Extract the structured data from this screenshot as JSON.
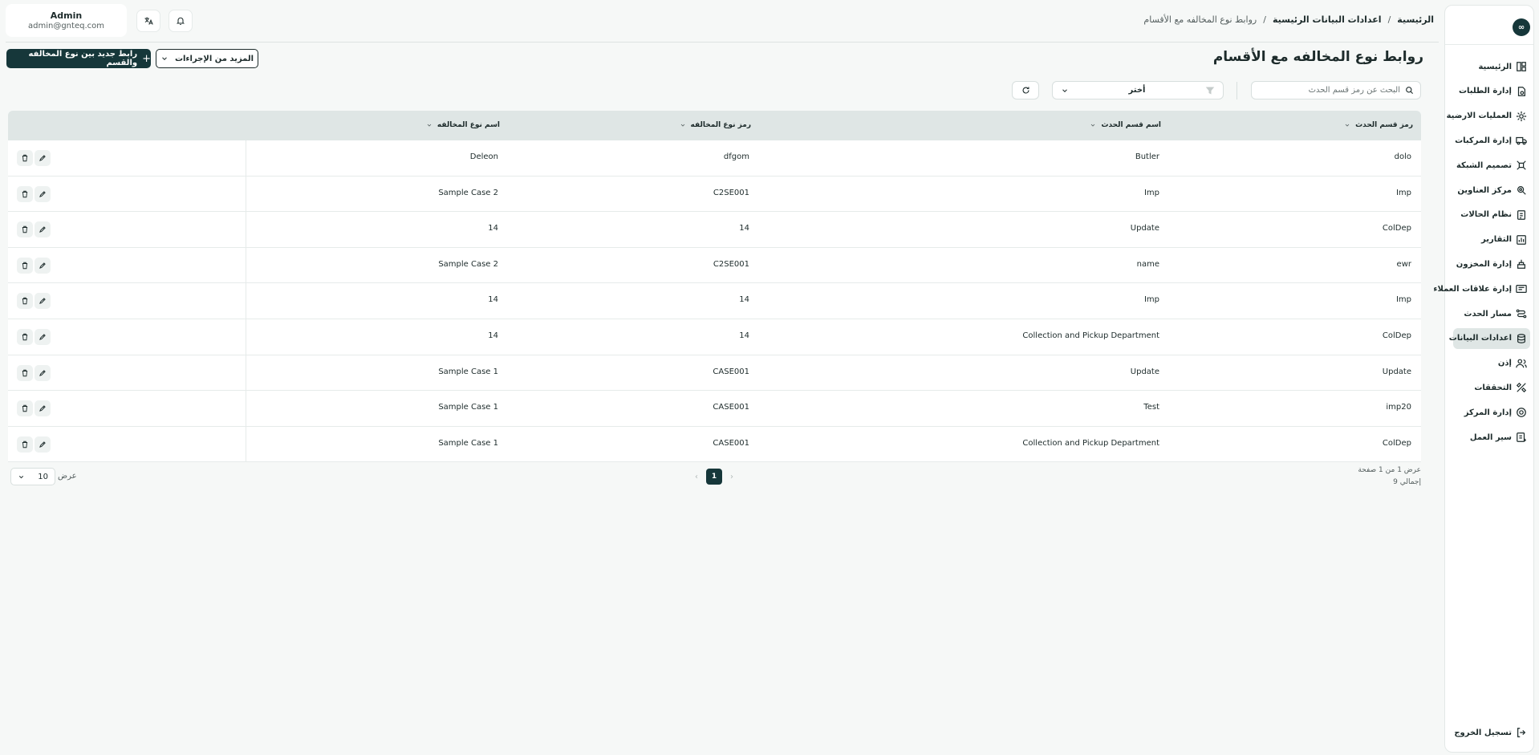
{
  "header": {
    "user": {
      "name": "Admin",
      "email": "admin@gnteq.com"
    },
    "breadcrumb": [
      "الرئيسية",
      "اعدادات البيانات الرئيسية",
      "روابط نوع المخالفه مع الأقسام"
    ],
    "breadcrumb_sep": "/"
  },
  "sidebar": {
    "logo": "∞",
    "items": [
      {
        "label": "الرئيسية",
        "icon": "dashboard-icon"
      },
      {
        "label": "إدارة الطلبات",
        "icon": "orders-icon"
      },
      {
        "label": "العمليات الارضية",
        "icon": "ground-ops-icon"
      },
      {
        "label": "إدارة المركبات",
        "icon": "truck-icon"
      },
      {
        "label": "تصميم الشبكة",
        "icon": "network-icon"
      },
      {
        "label": "مركز العناوين",
        "icon": "address-icon"
      },
      {
        "label": "نظام الحالات",
        "icon": "status-icon"
      },
      {
        "label": "التقارير",
        "icon": "reports-icon"
      },
      {
        "label": "إدارة المخزون",
        "icon": "inventory-icon"
      },
      {
        "label": "إدارة علاقات العملاء",
        "icon": "crm-icon"
      },
      {
        "label": "مسار الحدث",
        "icon": "route-icon"
      },
      {
        "label": "اعدادات البيانات",
        "icon": "database-icon",
        "active": true
      },
      {
        "label": "إذن",
        "icon": "users-icon"
      },
      {
        "label": "التحققات",
        "icon": "verification-icon"
      },
      {
        "label": "إدارة المركز",
        "icon": "center-icon"
      },
      {
        "label": "سير العمل",
        "icon": "workflow-icon"
      }
    ],
    "logout": "تسجيل الخروج"
  },
  "page": {
    "title": "روابط نوع المخالفه مع الأقسام",
    "new_button": "رابط جديد بين نوع المخالفه والقسم",
    "more_actions": "المزيد من الإجراءات"
  },
  "filters": {
    "search_placeholder": "البحث عن رمز قسم الحدث",
    "select_value": "أختر"
  },
  "table": {
    "columns": [
      "رمز قسم الحدث",
      "اسم قسم الحدث",
      "رمز نوع المخالفه",
      "اسم نوع المخالفه"
    ],
    "rows": [
      [
        "dolo",
        "Butler",
        "dfgom",
        "Deleon"
      ],
      [
        "Imp",
        "Imp",
        "C2SE001",
        "Sample Case 2"
      ],
      [
        "ColDep",
        "Update",
        "14",
        "14"
      ],
      [
        "ewr",
        "name",
        "C2SE001",
        "Sample Case 2"
      ],
      [
        "Imp",
        "Imp",
        "14",
        "14"
      ],
      [
        "ColDep",
        "Collection and Pickup Department",
        "14",
        "14"
      ],
      [
        "Update",
        "Update",
        "CASE001",
        "Sample Case 1"
      ],
      [
        "imp20",
        "Test",
        "CASE001",
        "Sample Case 1"
      ],
      [
        "ColDep",
        "Collection and Pickup Department",
        "CASE001",
        "Sample Case 1"
      ]
    ]
  },
  "pagination": {
    "info": "عرض 1 من 1 صفحة",
    "total": "إجمالي 9",
    "current_page": "1",
    "page_size": "10",
    "page_size_label": "عرض"
  },
  "colors": {
    "primary": "#16373a",
    "header_bg": "#dfe6e5",
    "page_bg": "#f6f8f7"
  }
}
